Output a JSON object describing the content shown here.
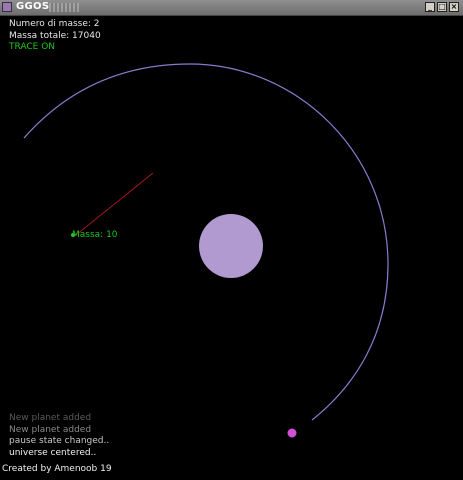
{
  "window": {
    "title": "GGOS",
    "buttons": {
      "minimize": "_",
      "maximize": "□",
      "close": "×"
    }
  },
  "hud": {
    "count_label": "Numero di masse: 2",
    "total_mass_label": "Massa totale: 17040",
    "trace_label": "TRACE ON"
  },
  "scene": {
    "planet_label": "Massa: 10",
    "colors": {
      "sun": "#b09ad0",
      "orbit_trace": "#8c7acc",
      "velocity_vector": "#a01818",
      "planet": "#27c227",
      "moving_body": "#d050d8",
      "hud_green": "#1ec71e"
    }
  },
  "log": [
    {
      "text": "New planet added",
      "color": "#5a5a5a"
    },
    {
      "text": "New planet added",
      "color": "#8a8a8a"
    },
    {
      "text": "pause state changed..",
      "color": "#c8c8c8"
    },
    {
      "text": "universe centered..",
      "color": "#f0f0f0"
    }
  ],
  "footer": "Created by Amenoob 19"
}
